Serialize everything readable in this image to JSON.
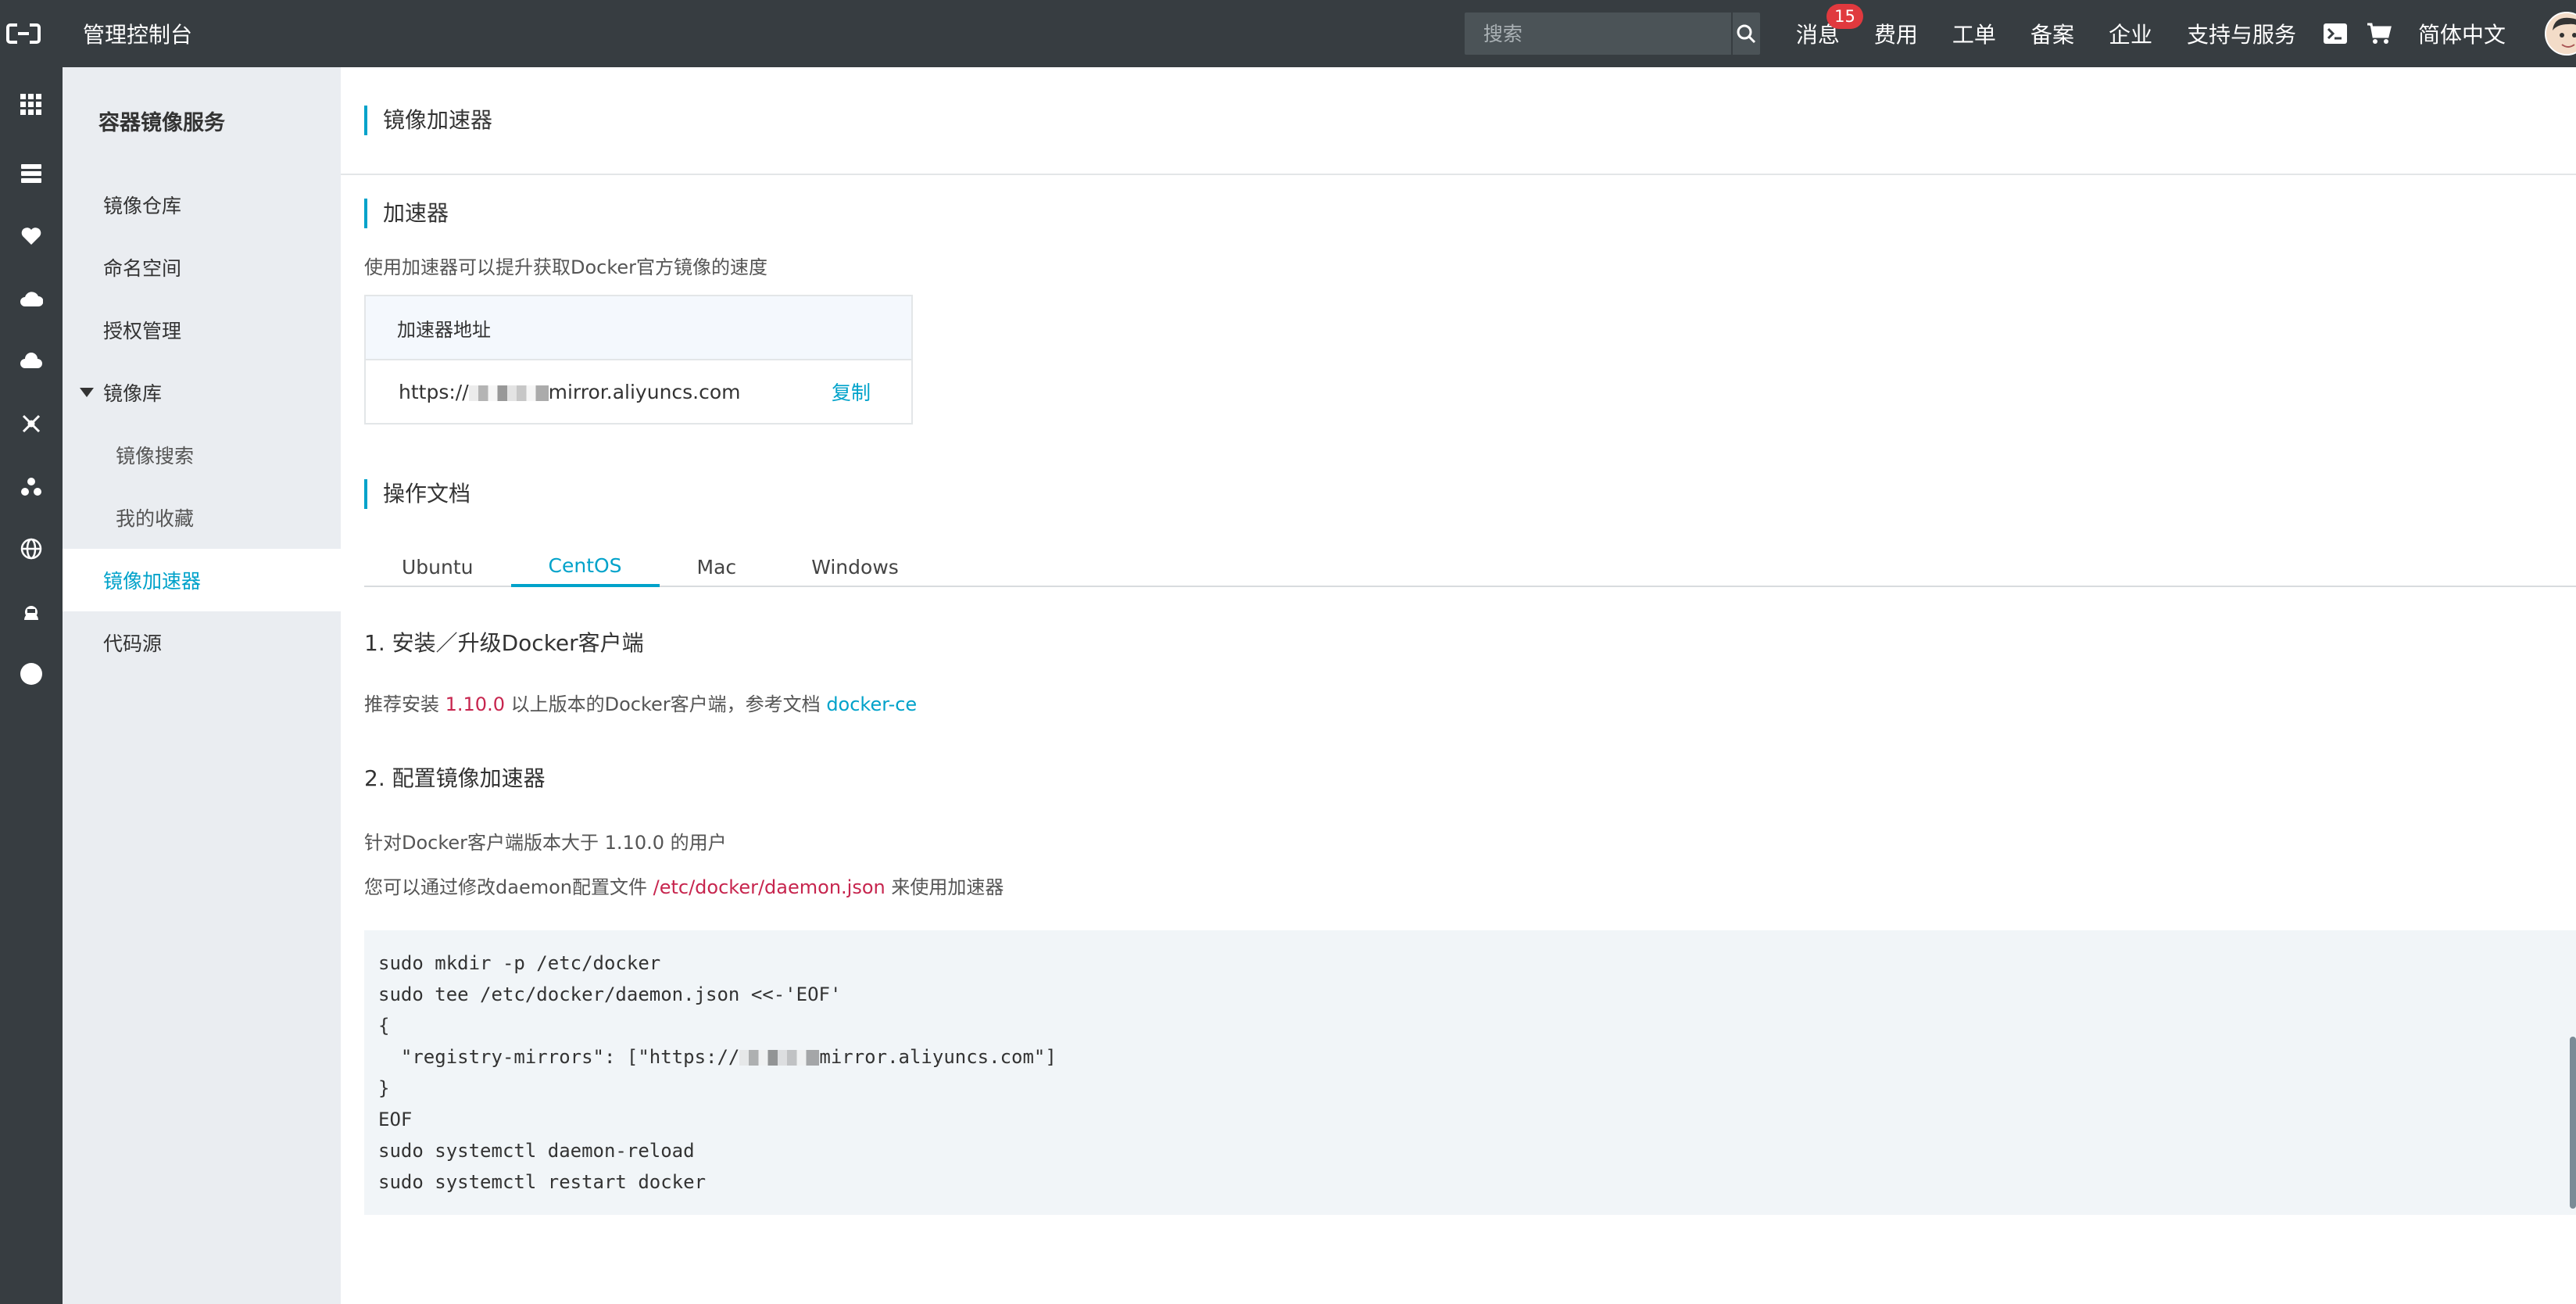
{
  "topbar": {
    "console_title": "管理控制台",
    "search_placeholder": "搜索",
    "nav": {
      "messages": "消息",
      "messages_count": "15",
      "fees": "费用",
      "tickets": "工单",
      "icp": "备案",
      "enterprise": "企业",
      "support": "支持与服务",
      "language": "简体中文"
    }
  },
  "rail": {
    "icons": [
      "grid-icon",
      "server-icon",
      "heart-icon",
      "cloud-upload-icon",
      "cloud-download-icon",
      "network-icon",
      "cluster-icon",
      "globe-icon",
      "robot-icon",
      "circle-icon"
    ]
  },
  "sidebar": {
    "title": "容器镜像服务",
    "items": {
      "repos": "镜像仓库",
      "namespace": "命名空间",
      "auth": "授权管理",
      "library": "镜像库",
      "search": "镜像搜索",
      "favorites": "我的收藏",
      "accelerator": "镜像加速器",
      "source": "代码源"
    }
  },
  "main": {
    "page_title": "镜像加速器",
    "accelerator": {
      "section_title": "加速器",
      "description": "使用加速器可以提升获取Docker官方镜像的速度",
      "box_header": "加速器地址",
      "url_prefix": "https://",
      "url_suffix": "mirror.aliyuncs.com",
      "copy": "复制"
    },
    "docs": {
      "section_title": "操作文档",
      "tabs": [
        "Ubuntu",
        "CentOS",
        "Mac",
        "Windows"
      ],
      "active_tab": "CentOS",
      "step1_title": "1. 安装／升级Docker客户端",
      "step1_text_a": "推荐安装",
      "step1_version": "1.10.0",
      "step1_text_b": "以上版本的Docker客户端，参考文档",
      "step1_link": "docker-ce",
      "step2_title": "2. 配置镜像加速器",
      "step2_line1": "针对Docker客户端版本大于 1.10.0 的用户",
      "step2_line2_a": "您可以通过修改daemon配置文件",
      "step2_line2_path": "/etc/docker/daemon.json",
      "step2_line2_b": "来使用加速器",
      "code_lines": [
        "sudo mkdir -p /etc/docker",
        "sudo tee /etc/docker/daemon.json <<-'EOF'",
        "{",
        "  \"registry-mirrors\": [\"https://",
        "}",
        "EOF",
        "sudo systemctl daemon-reload",
        "sudo systemctl restart docker"
      ],
      "code_mirror_suffix": "mirror.aliyuncs.com\"]"
    }
  },
  "colors": {
    "topbar": "#373d41",
    "accent": "#00a2ca",
    "sidebar": "#eaedf1",
    "highlight": "#c7254e",
    "badge": "#e0393e"
  }
}
